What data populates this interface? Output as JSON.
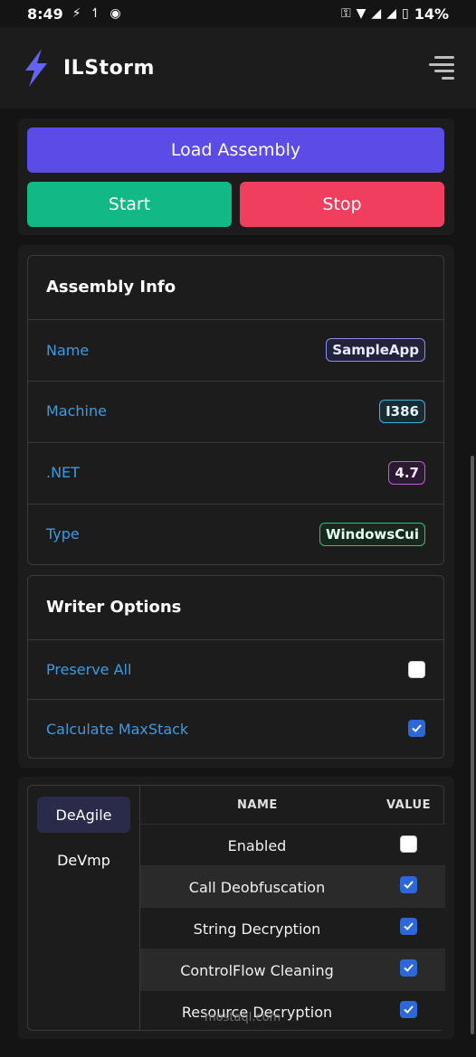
{
  "statusbar": {
    "time": "8:49",
    "battery": "14%"
  },
  "header": {
    "brand": "ILStorm",
    "accent_color": "#5b5bf0"
  },
  "controls": {
    "load_label": "Load Assembly",
    "start_label": "Start",
    "stop_label": "Stop",
    "colors": {
      "load": "#5b4ce8",
      "start": "#12b886",
      "stop": "#f03e5e"
    }
  },
  "assembly_info": {
    "title": "Assembly Info",
    "rows": [
      {
        "label": "Name",
        "value": "SampleApp",
        "color": "#8b8bf5"
      },
      {
        "label": "Machine",
        "value": "I386",
        "color": "#3bb5e0"
      },
      {
        "label": ".NET",
        "value": "4.7",
        "color": "#c05ad8"
      },
      {
        "label": "Type",
        "value": "WindowsCui",
        "color": "#2fbf78"
      }
    ]
  },
  "writer_options": {
    "title": "Writer Options",
    "rows": [
      {
        "label": "Preserve All",
        "checked": false
      },
      {
        "label": "Calculate MaxStack",
        "checked": true
      }
    ]
  },
  "deobfuscators": {
    "tabs": [
      {
        "label": "DeAgile",
        "active": true
      },
      {
        "label": "DeVmp",
        "active": false
      }
    ],
    "columns": {
      "name": "NAME",
      "value": "VALUE"
    },
    "rows": [
      {
        "name": "Enabled",
        "checked": false
      },
      {
        "name": "Call Deobfuscation",
        "checked": true
      },
      {
        "name": "String Decryption",
        "checked": true
      },
      {
        "name": "ControlFlow Cleaning",
        "checked": true
      },
      {
        "name": "Resource Decryption",
        "checked": true
      }
    ]
  },
  "watermark": "mostaql.com"
}
